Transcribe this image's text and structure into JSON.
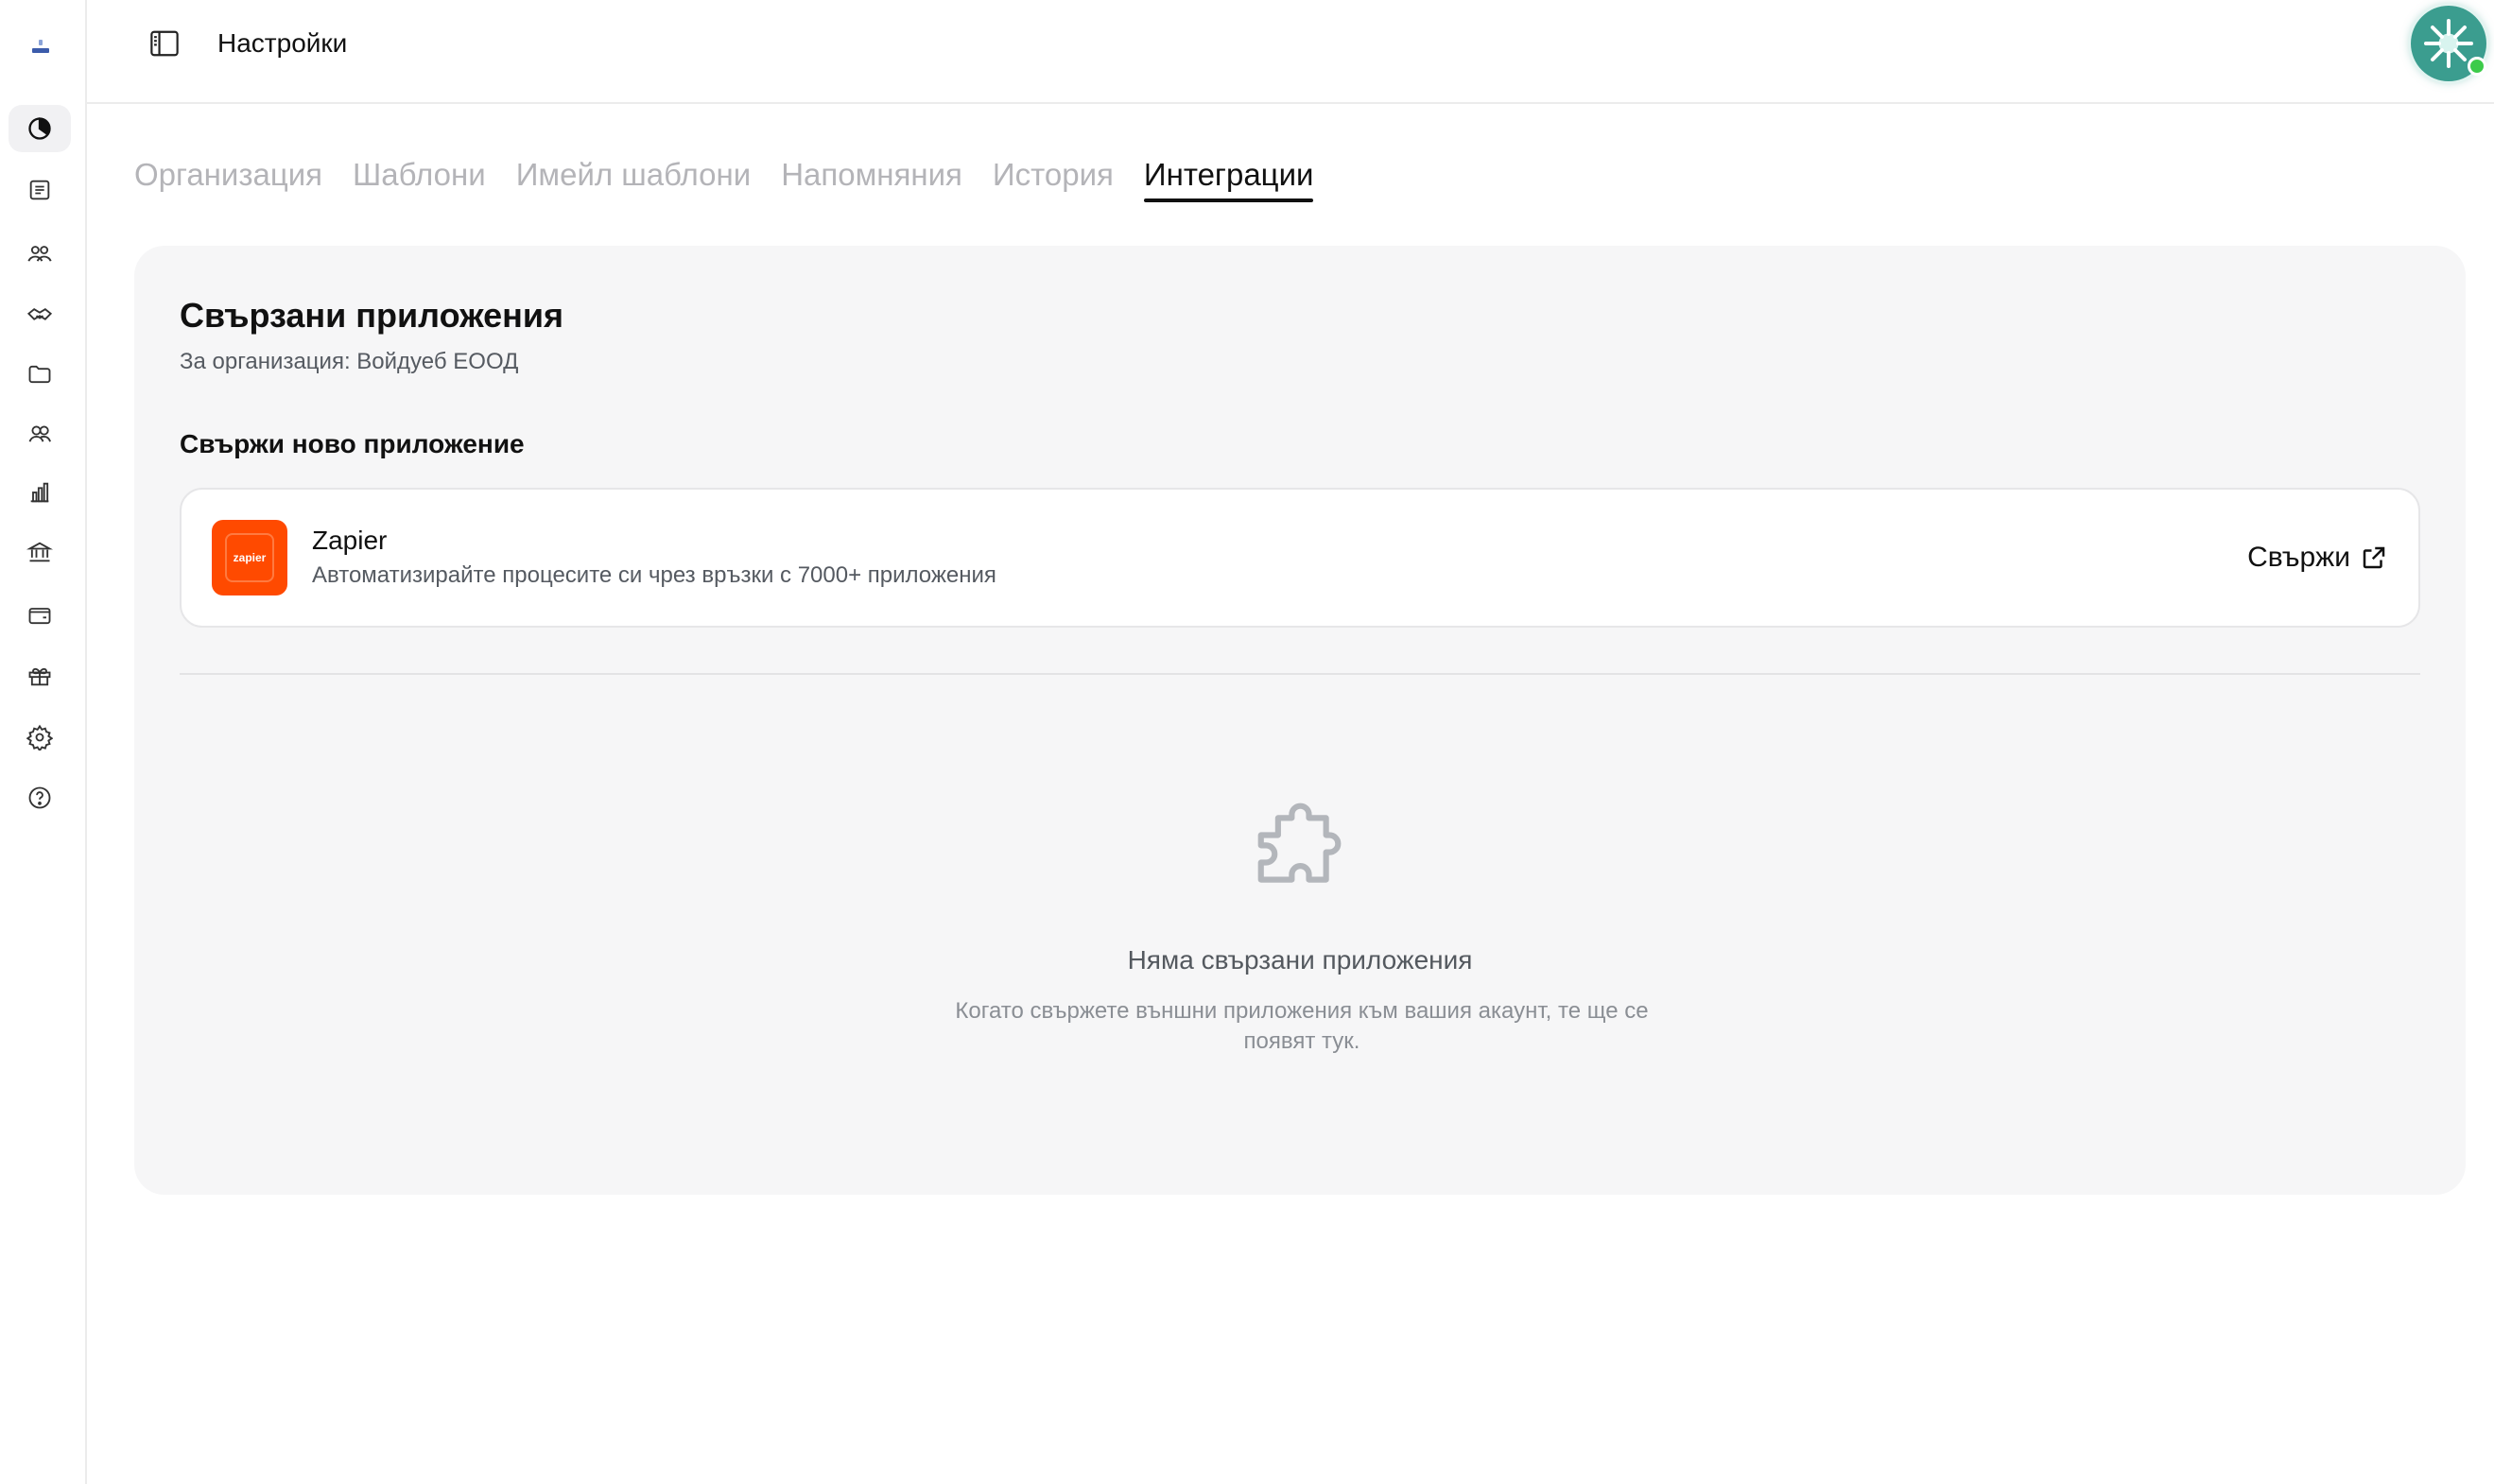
{
  "header": {
    "title": "Настройки"
  },
  "sidebar": {
    "items": [
      {
        "icon": "pie-chart-icon",
        "active": true
      },
      {
        "icon": "document-list-icon",
        "active": false
      },
      {
        "icon": "users-group-icon",
        "active": false
      },
      {
        "icon": "handshake-icon",
        "active": false
      },
      {
        "icon": "folder-icon",
        "active": false
      },
      {
        "icon": "contacts-icon",
        "active": false
      },
      {
        "icon": "bar-chart-icon",
        "active": false
      },
      {
        "icon": "bank-icon",
        "active": false
      },
      {
        "icon": "wallet-icon",
        "active": false
      },
      {
        "icon": "gift-icon",
        "active": false
      },
      {
        "icon": "gear-icon",
        "active": false
      },
      {
        "icon": "help-icon",
        "active": false
      }
    ]
  },
  "tabs": [
    {
      "label": "Организация",
      "active": false
    },
    {
      "label": "Шаблони",
      "active": false
    },
    {
      "label": "Имейл шаблони",
      "active": false
    },
    {
      "label": "Напомняния",
      "active": false
    },
    {
      "label": "История",
      "active": false
    },
    {
      "label": "Интеграции",
      "active": true
    }
  ],
  "panel": {
    "title": "Свързани приложения",
    "subtitle": "За организация: Войдуеб ЕООД",
    "section_title": "Свържи ново приложение",
    "app": {
      "logo_text": "zapier",
      "name": "Zapier",
      "description": "Автоматизирайте процесите си чрез връзки с 7000+ приложения",
      "connect_label": "Свържи"
    },
    "empty": {
      "icon": "puzzle-icon",
      "title": "Няма свързани приложения",
      "description": "Когато свържете външни приложения към вашия акаунт, те ще се появят тук."
    }
  },
  "colors": {
    "accent": "#111111",
    "zapier_brand": "#ff4a00",
    "panel_bg": "#f6f6f7",
    "online": "#3ccb4a"
  }
}
